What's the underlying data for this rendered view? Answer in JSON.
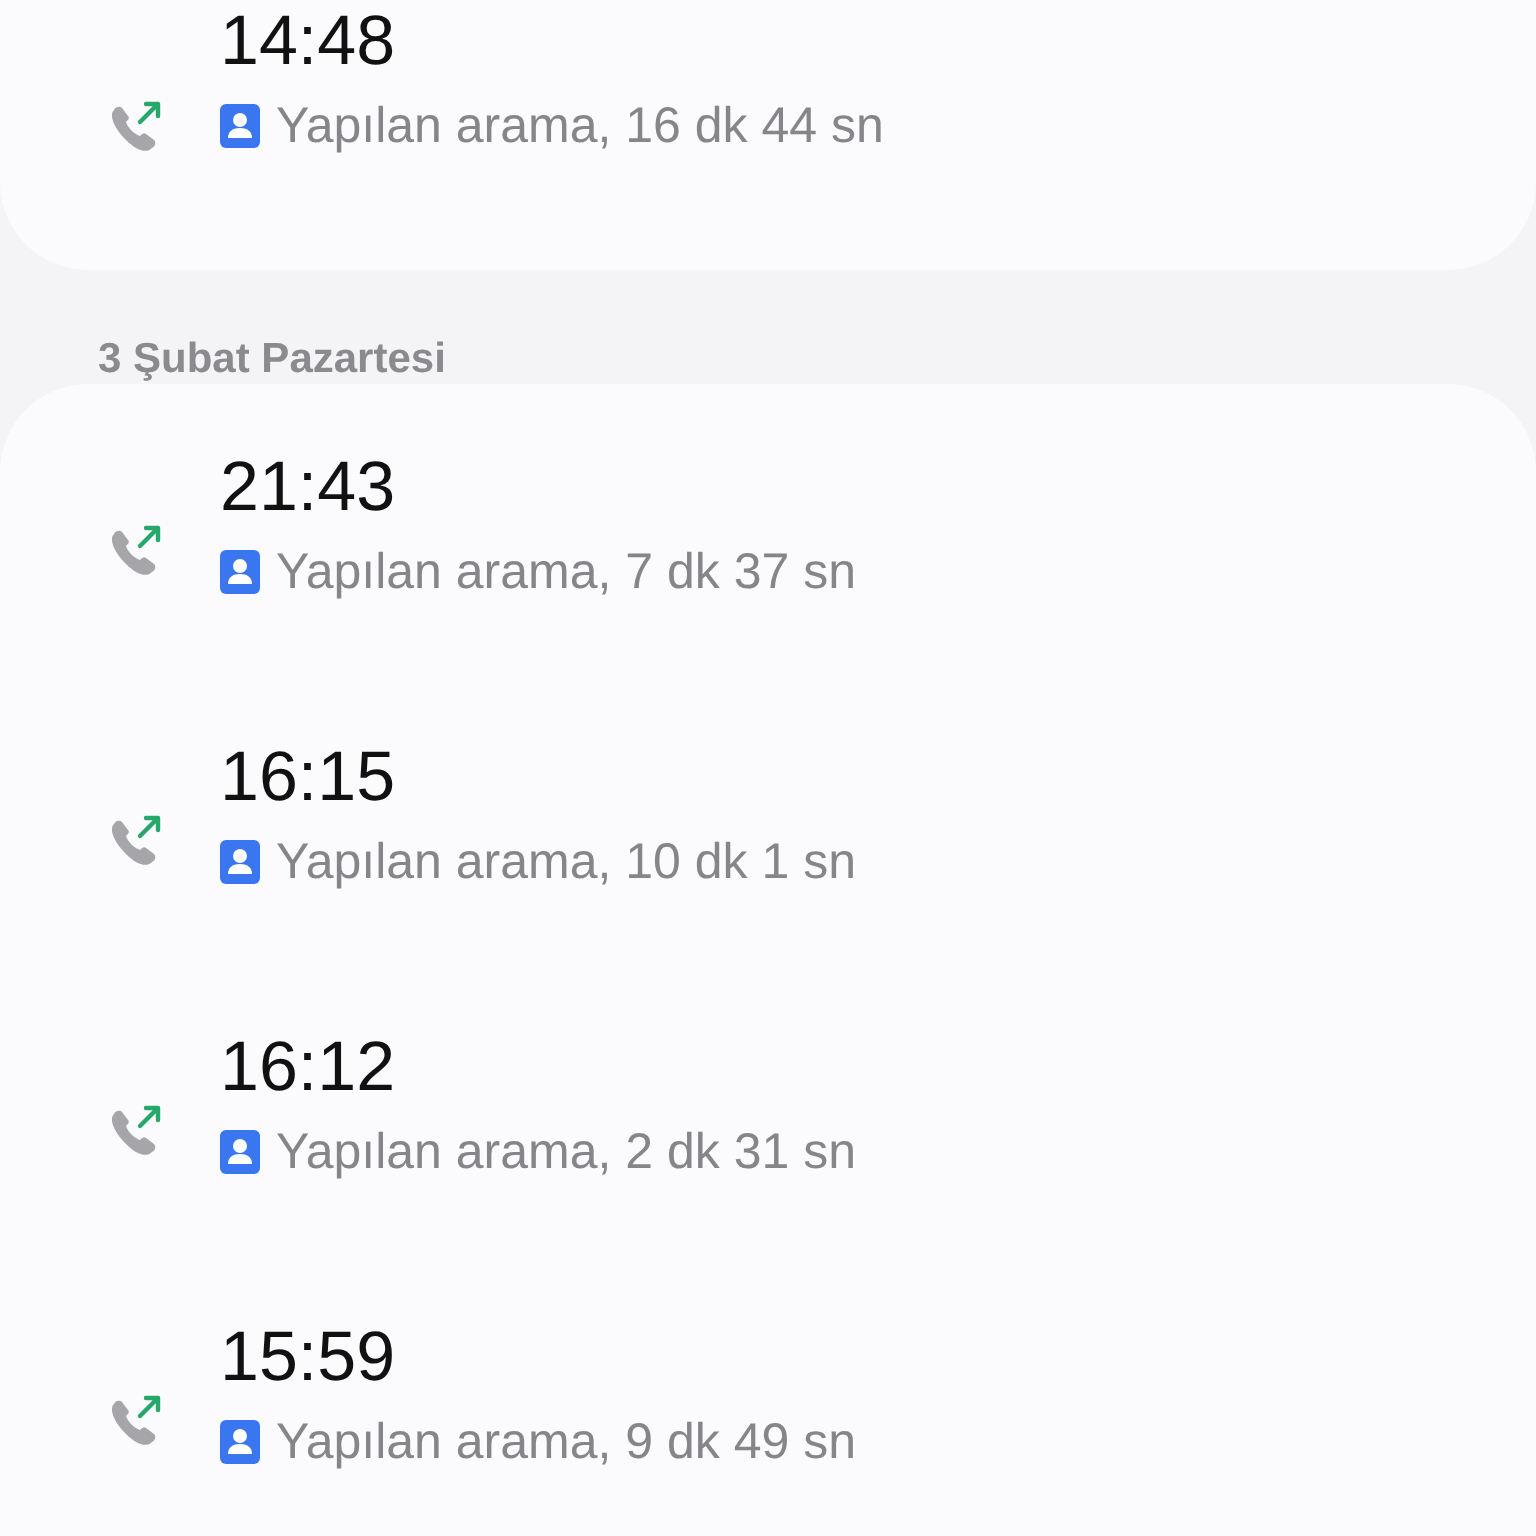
{
  "sections": [
    {
      "calls": [
        {
          "time": "14:48",
          "detail": "Yapılan arama, 16 dk 44 sn",
          "kind": "outgoing"
        }
      ]
    },
    {
      "header": "3 Şubat Pazartesi",
      "calls": [
        {
          "time": "21:43",
          "detail": "Yapılan arama, 7 dk 37 sn",
          "kind": "outgoing"
        },
        {
          "time": "16:15",
          "detail": "Yapılan arama, 10 dk 1 sn",
          "kind": "outgoing"
        },
        {
          "time": "16:12",
          "detail": "Yapılan arama, 2 dk 31 sn",
          "kind": "outgoing"
        },
        {
          "time": "15:59",
          "detail": "Yapılan arama, 9 dk 49 sn",
          "kind": "outgoing"
        }
      ]
    }
  ]
}
